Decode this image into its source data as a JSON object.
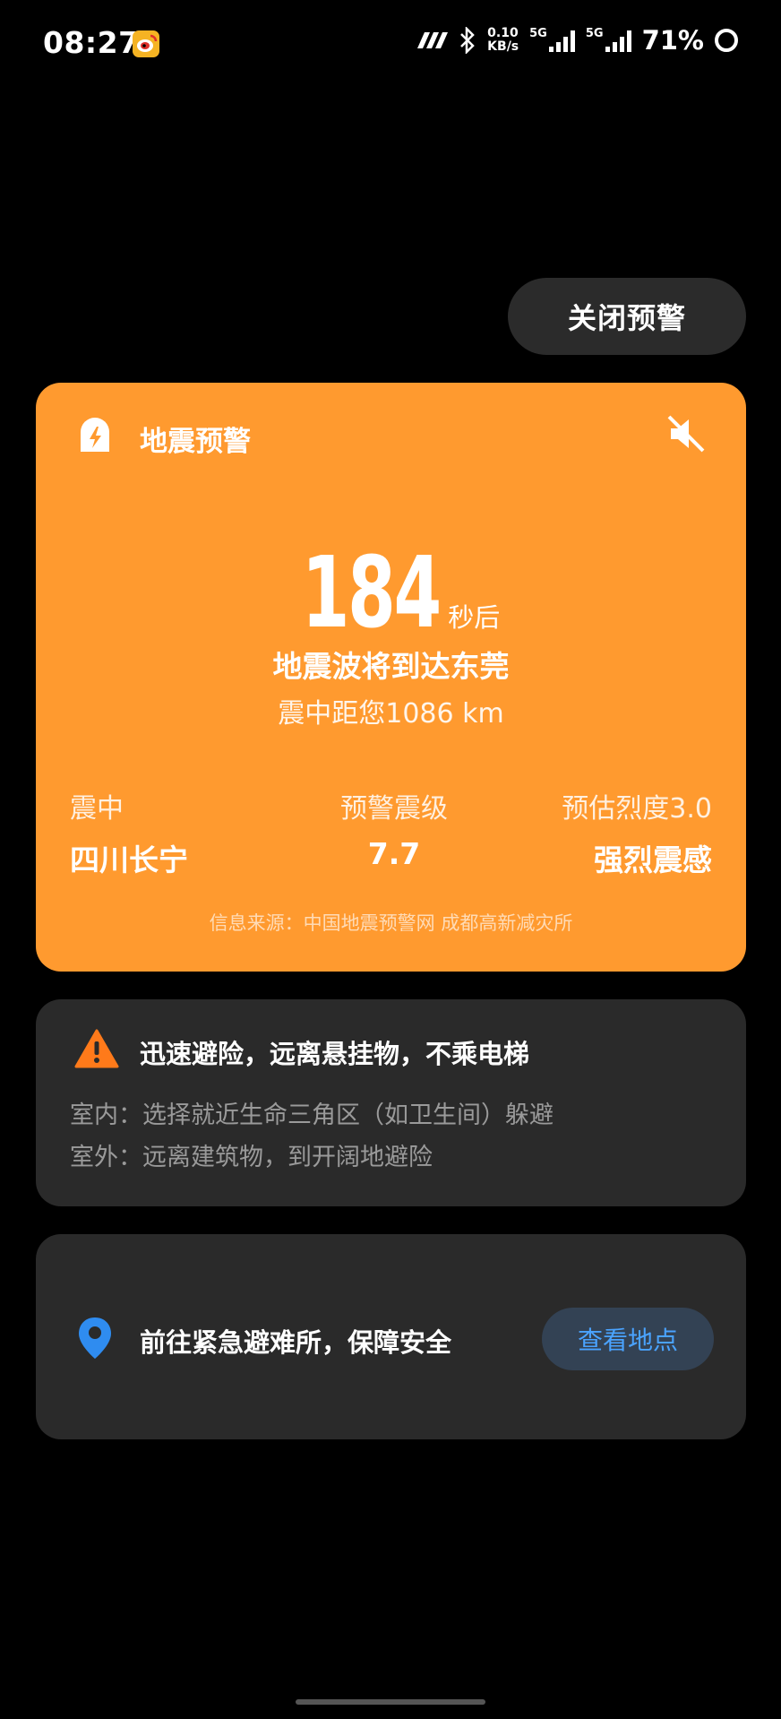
{
  "status_bar": {
    "time": "08:27",
    "speed_value": "0.10",
    "speed_unit": "KB/s",
    "net1": "5G",
    "net2": "5G",
    "battery": "71%",
    "icons": [
      "weibo-icon",
      "nfc-icon",
      "bluetooth-icon",
      "signal-icon",
      "signal-icon",
      "battery-ring-icon"
    ]
  },
  "close_button": {
    "label": "关闭预警"
  },
  "alert": {
    "title": "地震预警",
    "countdown_seconds": "184",
    "countdown_unit": "秒后",
    "arrive_text": "地震波将到达东莞",
    "distance_text": "震中距您1086 km",
    "epicenter_label": "震中",
    "epicenter_value": "四川长宁",
    "magnitude_label": "预警震级",
    "magnitude_value": "7.7",
    "intensity_label": "预估烈度3.0",
    "intensity_value": "强烈震感",
    "source": "信息来源：中国地震预警网 成都高新减灾所",
    "background_color": "#ff9a2f"
  },
  "advice": {
    "title": "迅速避险，远离悬挂物，不乘电梯",
    "indoor": "室内：选择就近生命三角区（如卫生间）躲避",
    "outdoor": "室外：远离建筑物，到开阔地避险"
  },
  "shelter": {
    "text": "前往紧急避难所，保障安全",
    "button_label": "查看地点",
    "button_color": "#4aa3ff"
  }
}
